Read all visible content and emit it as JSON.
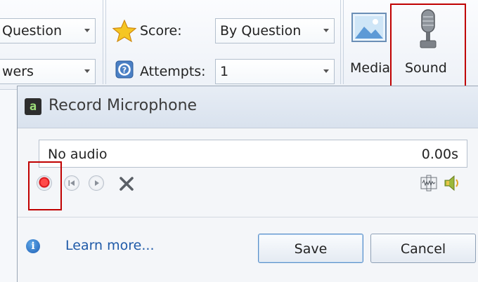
{
  "ribbon": {
    "question_combo": "Question",
    "answers_combo": "wers",
    "score_label": "Score:",
    "score_value": "By Question",
    "attempts_label": "Attempts:",
    "attempts_value": "1",
    "media_label": "Media",
    "sound_label": "Sound"
  },
  "dialog": {
    "title": "Record Microphone",
    "audio_status": "No audio",
    "audio_time": "0.00s",
    "learn_more": "Learn more...",
    "save_label": "Save",
    "cancel_label": "Cancel"
  },
  "colors": {
    "highlight": "#c00000",
    "record": "#d9161b",
    "link": "#1f5aa8"
  }
}
